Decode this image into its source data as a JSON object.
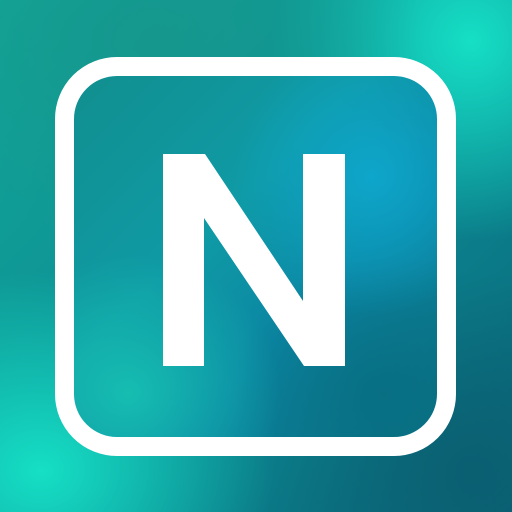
{
  "icon": {
    "letter": "N",
    "colors": {
      "frame": "#ffffff",
      "letter": "#ffffff",
      "background_teal": "#12a898",
      "background_mint": "#16e4c8",
      "background_deep": "#0a6478",
      "inner_blue": "#0eaad2"
    }
  }
}
